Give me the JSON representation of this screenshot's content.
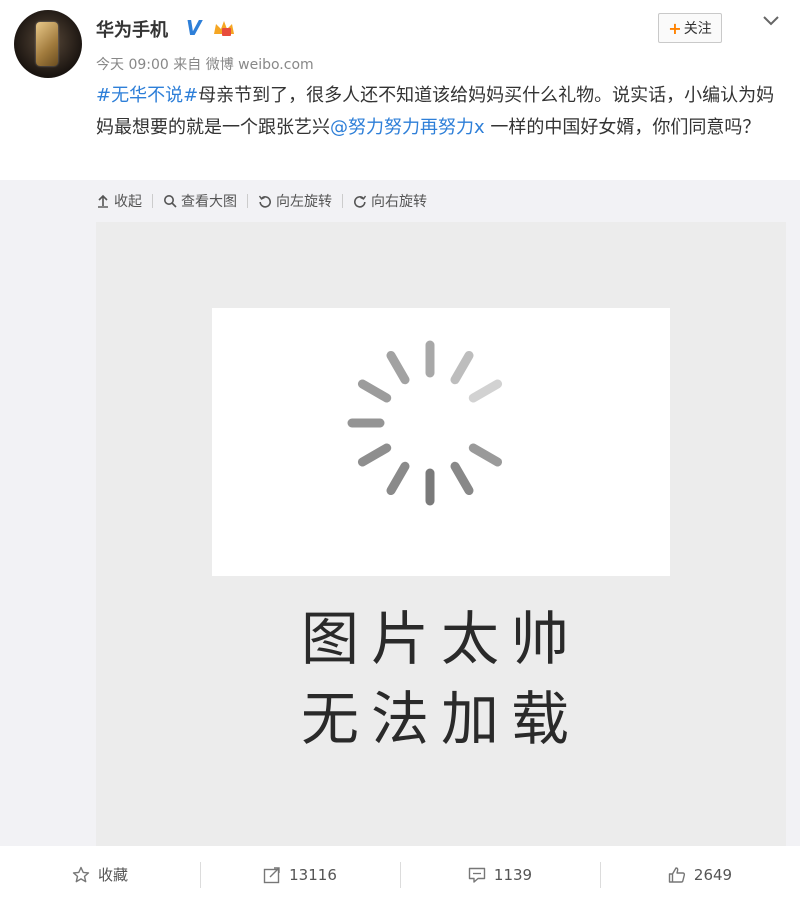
{
  "user": {
    "name": "华为手机",
    "verified_mark": "V",
    "time": "今天 09:00",
    "source_prefix": "来自",
    "source": "微博 weibo.com"
  },
  "follow": {
    "label": "关注"
  },
  "post": {
    "hashtag": "#无华不说#",
    "text_a": "母亲节到了，很多人还不知道该给妈妈买什么礼物。说实话，小编认为妈妈最想要的就是一个跟张艺兴",
    "mention": "@努力努力再努力x",
    "text_b": " 一样的中国好女婿，你们同意吗？"
  },
  "toolbar": {
    "collapse": "收起",
    "view_large": "查看大图",
    "rotate_left": "向左旋转",
    "rotate_right": "向右旋转"
  },
  "image": {
    "caption_line1": "图片太帅",
    "caption_line2": "无法加载"
  },
  "actions": {
    "favorite": "收藏",
    "repost_count": "13116",
    "comment_count": "1139",
    "like_count": "2649"
  },
  "colors": {
    "link": "#2e7fd8",
    "follow_plus": "#ff8200"
  }
}
